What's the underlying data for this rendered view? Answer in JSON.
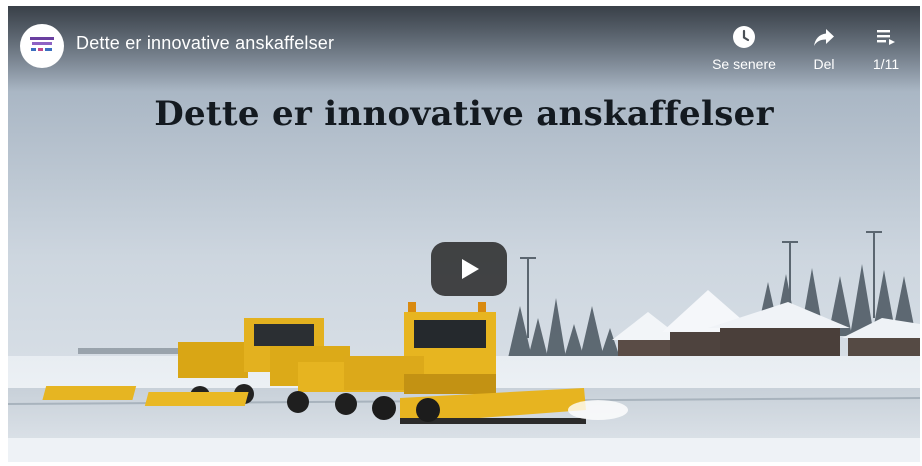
{
  "player": {
    "title": "Dette er innovative anskaffelser",
    "headline": "Dette er innovative anskaffelser",
    "controls": {
      "watch_later_label": "Se senere",
      "share_label": "Del",
      "playlist_position": "1/11"
    },
    "icons": {
      "watch_later": "clock-icon",
      "share": "share-arrow-icon",
      "playlist": "playlist-icon",
      "play": "play-icon",
      "channel": "channel-logo-icon"
    },
    "colors": {
      "sky": "#c9d2dc",
      "snow": "#e9eef3",
      "machine_yellow": "#e5b21b",
      "overlay_text": "#ffffff",
      "headline_text": "#141a20"
    }
  }
}
